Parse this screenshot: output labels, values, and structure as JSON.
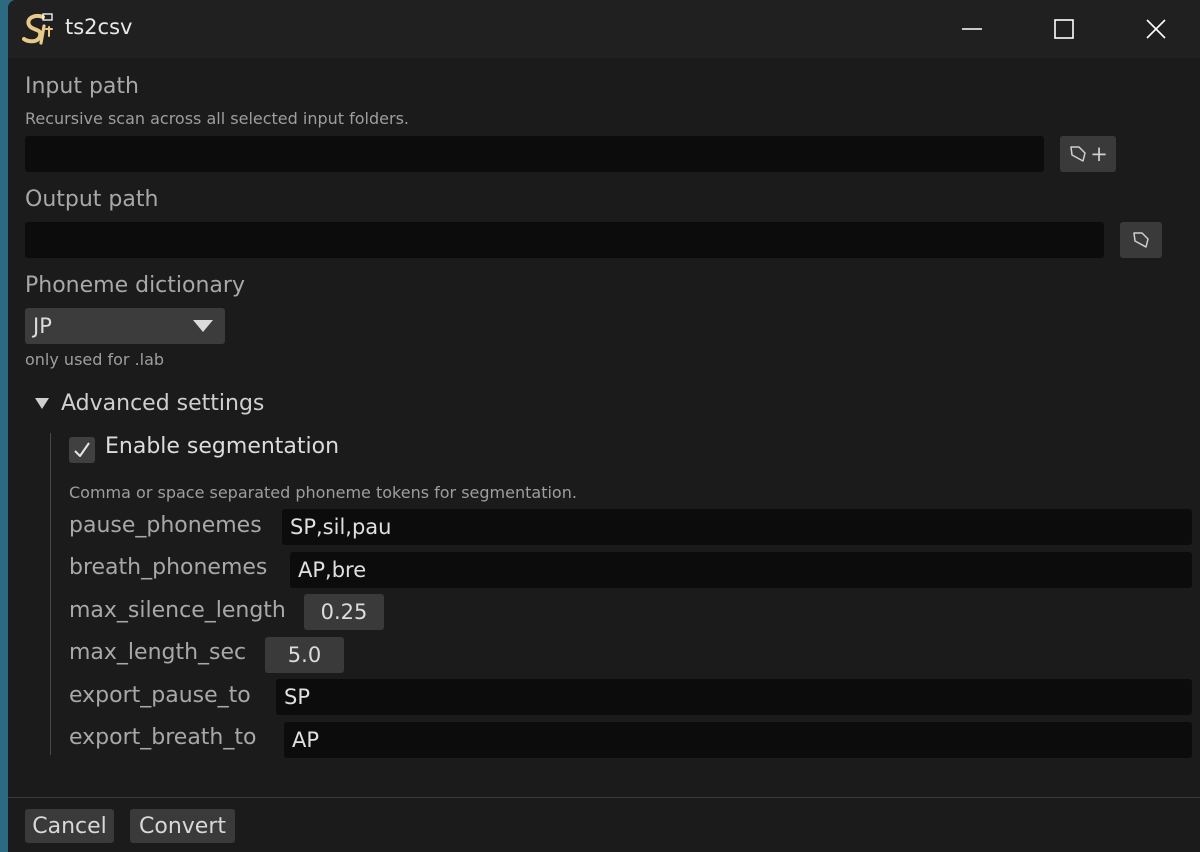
{
  "window": {
    "title": "ts2csv"
  },
  "input": {
    "label": "Input path",
    "hint": "Recursive scan across all selected input folders.",
    "value": "",
    "add_symbol": "+"
  },
  "output": {
    "label": "Output path",
    "value": ""
  },
  "dictionary": {
    "label": "Phoneme dictionary",
    "selected": "JP",
    "hint": "only used for .lab"
  },
  "advanced": {
    "title": "Advanced settings",
    "segmentation_label": "Enable segmentation",
    "segmentation_enabled": true,
    "hint": "Comma or space separated phoneme tokens for segmentation.",
    "params": {
      "pause_phonemes": {
        "label": "pause_phonemes",
        "value": "SP,sil,pau"
      },
      "breath_phonemes": {
        "label": "breath_phonemes",
        "value": "AP,bre"
      },
      "max_silence_length": {
        "label": "max_silence_length",
        "value": "0.25"
      },
      "max_length_sec": {
        "label": "max_length_sec",
        "value": "5.0"
      },
      "export_pause_to": {
        "label": "export_pause_to",
        "value": "SP"
      },
      "export_breath_to": {
        "label": "export_breath_to",
        "value": "AP"
      }
    }
  },
  "footer": {
    "cancel_label": "Cancel",
    "convert_label": "Convert"
  },
  "colors": {
    "window_bg": "#1b1b1b",
    "titlebar_bg": "#202020",
    "input_bg": "#0c0c0c",
    "button_bg": "#3a3a3a"
  },
  "icons": {
    "app": "si-logo-icon",
    "minimize": "minimize-icon",
    "maximize": "maximize-icon",
    "close": "close-icon",
    "folder": "folder-icon",
    "expand": "triangle-down-icon",
    "check": "checkmark-icon"
  }
}
